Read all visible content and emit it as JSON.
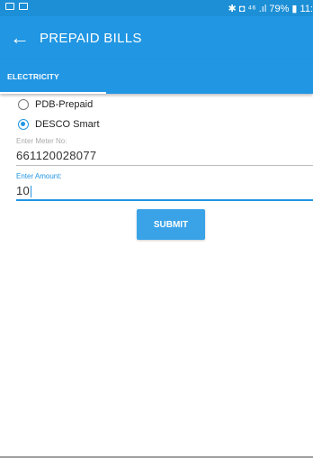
{
  "status_bar": {
    "right_text": "✱ ◘ ⁴⁶ .ıl 79% ▮ 11:",
    "left_icons": [
      "mail-icon",
      "image-icon"
    ]
  },
  "appbar": {
    "back_icon": "←",
    "title": "PREPAID BILLS"
  },
  "tabs": [
    {
      "label": "ELECTRICITY",
      "selected": true
    }
  ],
  "radio_options": [
    {
      "label": "PDB-Prepaid",
      "checked": false
    },
    {
      "label": "DESCO Smart",
      "checked": true
    }
  ],
  "meter_field": {
    "label": "Enter Meter No:",
    "value": "661120028077"
  },
  "amount_field": {
    "label": "Enter Amount:",
    "value": "10"
  },
  "submit_label": "SUBMIT",
  "colors": {
    "primary": "#2196e3",
    "status_bar": "#1c8fd6",
    "button": "#3aa3e8"
  }
}
